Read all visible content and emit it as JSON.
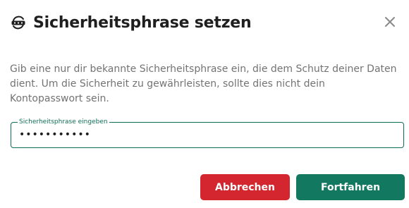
{
  "dialog": {
    "title": "Sicherheitsphrase setzen",
    "title_icon": "shield-key-icon",
    "close_icon": "close-icon",
    "description": "Gib eine nur dir bekannte Sicherheitsphrase ein, die dem Schutz deiner Daten dient. Um die Sicherheit zu gewährleisten, sollte dies nicht dein Kontopasswort sein.",
    "field": {
      "label": "Sicherheitsphrase eingeben",
      "value": "•••••••••••"
    },
    "buttons": {
      "cancel_label": "Abbrechen",
      "continue_label": "Fortfahren"
    }
  },
  "colors": {
    "accent": "#137860",
    "danger": "#d3262e",
    "text_primary": "#1f1f1f",
    "text_secondary": "#737373"
  }
}
